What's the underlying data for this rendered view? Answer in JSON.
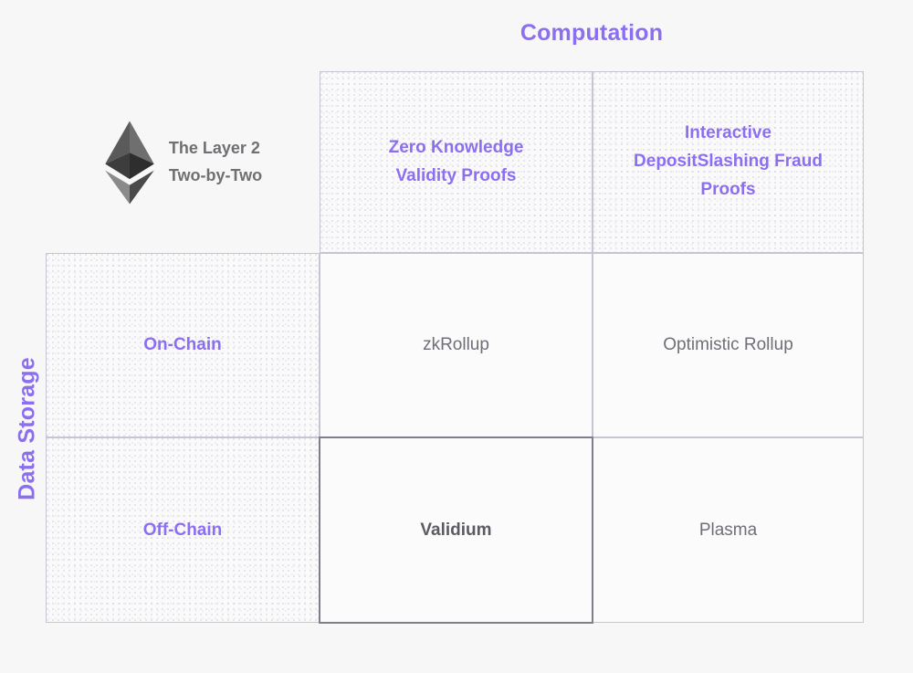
{
  "axes": {
    "column_axis_label": "Computation",
    "row_axis_label": "Data Storage"
  },
  "brand": {
    "logo_icon": "ethereum-logo",
    "title_line_1": "The Layer 2",
    "title_line_2": "Two-by-Two"
  },
  "colors": {
    "accent_purple": "#8c6ff0",
    "body_gray": "#6f6f78",
    "emphasis_gray": "#5b5b63",
    "border_light": "#c7c5d2",
    "border_highlight": "#807f89",
    "page_background": "#f7f7f7"
  },
  "matrix": {
    "column_headers": [
      {
        "line_1": "Zero Knowledge",
        "line_2": "Validity Proofs",
        "line_3": ""
      },
      {
        "line_1": "Interactive",
        "line_2": "DepositSlashing Fraud",
        "line_3": "Proofs"
      }
    ],
    "row_headers": [
      {
        "label": "On-Chain"
      },
      {
        "label": "Off-Chain"
      }
    ],
    "cells": [
      {
        "label": "zkRollup",
        "highlighted": false
      },
      {
        "label": "Optimistic Rollup",
        "highlighted": false
      },
      {
        "label": "Validium",
        "highlighted": true
      },
      {
        "label": "Plasma",
        "highlighted": false
      }
    ]
  }
}
